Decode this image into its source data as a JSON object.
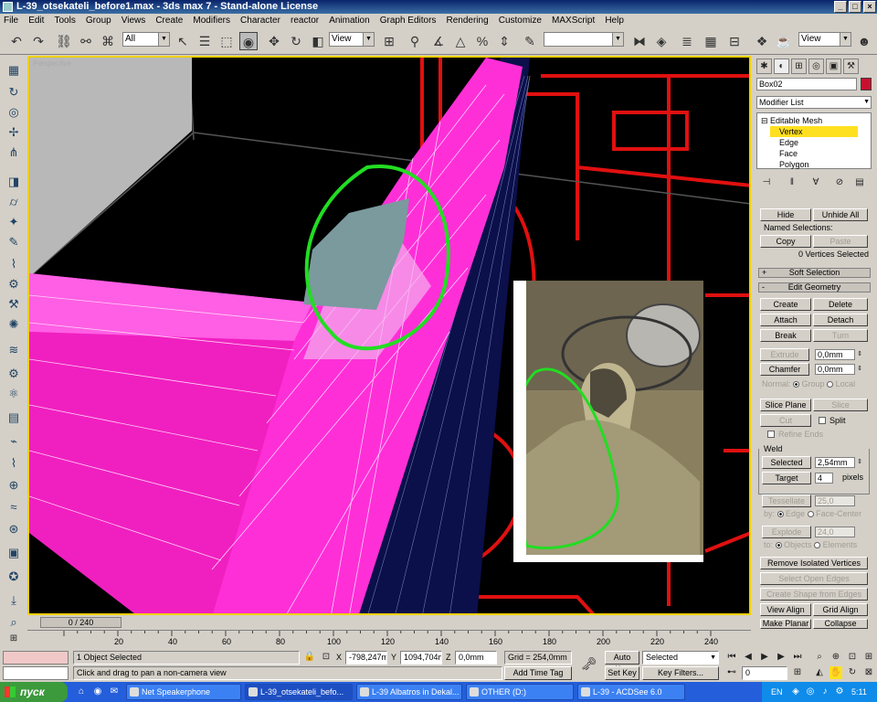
{
  "window": {
    "title": "L-39_otsekateli_before1.max - 3ds max 7 - Stand-alone License",
    "controls": [
      "_",
      "□",
      "×"
    ]
  },
  "menu": [
    "File",
    "Edit",
    "Tools",
    "Group",
    "Views",
    "Create",
    "Modifiers",
    "Character",
    "reactor",
    "Animation",
    "Graph Editors",
    "Rendering",
    "Customize",
    "MAXScript",
    "Help"
  ],
  "toolbar": {
    "selection_filter": "All",
    "ref_coord": "View",
    "named_selection": "",
    "render_view": "View"
  },
  "viewport": {
    "label": "Perspective"
  },
  "command_panel": {
    "object_name": "Box02",
    "object_color": "#c8102e",
    "modifier_list": "Modifier List",
    "stack": {
      "root": "Editable Mesh",
      "items": [
        "Vertex",
        "Edge",
        "Face",
        "Polygon"
      ],
      "selected": "Vertex"
    },
    "selection": {
      "hide": "Hide",
      "unhide_all": "Unhide All",
      "named_selections": "Named Selections:",
      "copy": "Copy",
      "paste": "Paste",
      "status": "0 Vertices Selected"
    },
    "soft_selection": "Soft Selection",
    "edit_geometry": {
      "title": "Edit Geometry",
      "create": "Create",
      "delete": "Delete",
      "attach": "Attach",
      "detach": "Detach",
      "break": "Break",
      "turn": "Turn",
      "extrude": "Extrude",
      "extrude_val": "0,0mm",
      "chamfer": "Chamfer",
      "chamfer_val": "0,0mm",
      "normal": "Normal:",
      "group": "Group",
      "local": "Local",
      "slice_plane": "Slice Plane",
      "slice": "Slice",
      "cut": "Cut",
      "split": "Split",
      "refine_ends": "Refine Ends",
      "weld_title": "Weld",
      "selected": "Selected",
      "selected_val": "2,54mm",
      "target": "Target",
      "target_val": "4",
      "pixels": "pixels",
      "tessellate": "Tessellate",
      "tessellate_val": "25,0",
      "by": "by:",
      "edge": "Edge",
      "face_center": "Face-Center",
      "explode": "Explode",
      "explode_val": "24,0",
      "to": "to:",
      "objects": "Objects",
      "elements": "Elements",
      "remove_isolated": "Remove Isolated Vertices",
      "select_open_edges": "Select Open Edges",
      "create_shape": "Create Shape from Edges",
      "view_align": "View Align",
      "grid_align": "Grid Align",
      "make_planar": "Make Planar",
      "collapse": "Collapse"
    }
  },
  "timeline": {
    "slider": "0 / 240",
    "ticks": [
      "20",
      "40",
      "60",
      "80",
      "100",
      "120",
      "140",
      "160",
      "180",
      "200",
      "220",
      "240"
    ]
  },
  "status": {
    "selected": "1 Object Selected",
    "prompt": "Click and drag to pan a non-camera view",
    "x_label": "X",
    "x": "-798,247mm",
    "y_label": "Y",
    "y": "1094,704m",
    "z_label": "Z",
    "z": "0,0mm",
    "grid": "Grid = 254,0mm",
    "add_time_tag": "Add Time Tag",
    "auto_key": "Auto Key",
    "set_key": "Set Key",
    "key_mode": "Selected",
    "key_filters": "Key Filters...",
    "frame": "0"
  },
  "taskbar": {
    "start": "пуск",
    "tasks": [
      "Net Speakerphone",
      "L-39_otsekateli_befo...",
      "L-39 Albatros in Dekal...",
      "OTHER (D:)",
      "L-39 - ACDSee 6.0"
    ],
    "lang": "EN",
    "clock": "5:11"
  },
  "colors": {
    "viewport_bg": "#000000",
    "mesh_pink": "#ff2fd8",
    "highlight_circle": "#22dd22",
    "blueprint_red": "#e01010",
    "active_border": "#f0d000"
  }
}
